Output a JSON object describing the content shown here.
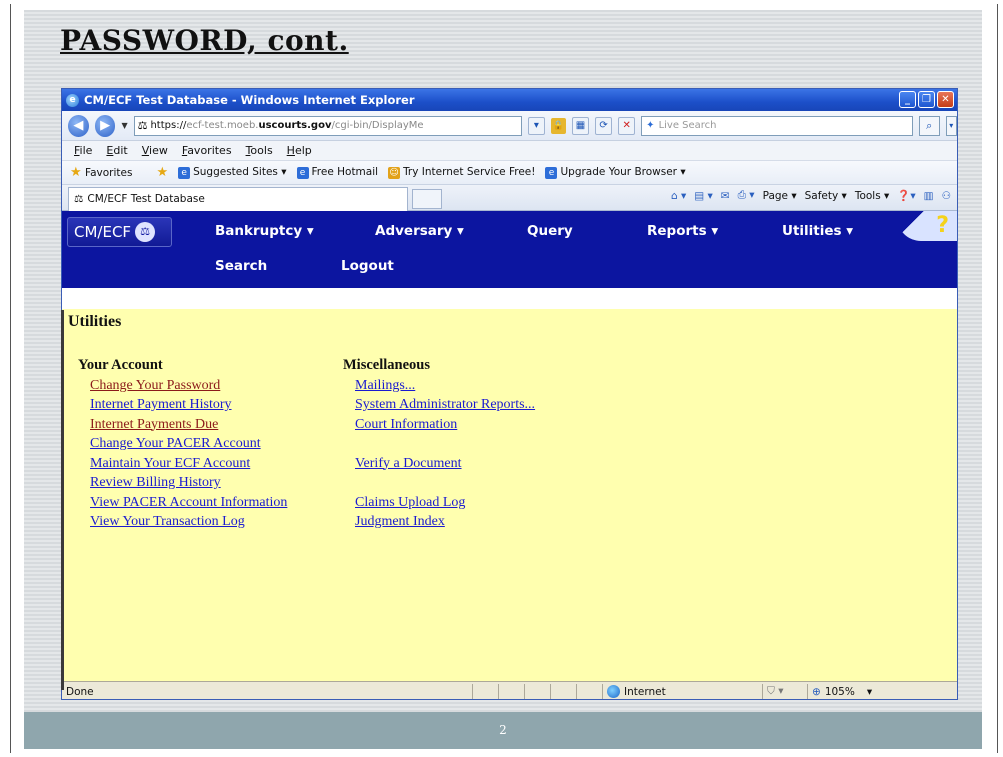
{
  "slide": {
    "title": "PASSWORD, cont.",
    "page_number": "2"
  },
  "window": {
    "title": "CM/ECF Test Database - Windows Internet Explorer",
    "address": {
      "scheme": "https://",
      "host_prefix": "ecf-test.moeb.",
      "host_domain": "uscourts.gov",
      "path": "/cgi-bin/DisplayMe"
    },
    "search_placeholder": "Live Search",
    "menu": [
      "File",
      "Edit",
      "View",
      "Favorites",
      "Tools",
      "Help"
    ],
    "favorites": {
      "label": "Favorites",
      "links": [
        "Suggested Sites ▾",
        "Free Hotmail",
        "Try Internet Service Free!",
        "Upgrade Your Browser ▾"
      ]
    },
    "tab_title": "CM/ECF Test Database",
    "command_bar": [
      "Page ▾",
      "Safety ▾",
      "Tools ▾"
    ],
    "status": {
      "text": "Done",
      "zone": "Internet",
      "zoom": "105%"
    }
  },
  "ecf": {
    "logo": "CM/ECF",
    "nav_row1": [
      "Bankruptcy ▾",
      "Adversary ▾",
      "Query",
      "Reports ▾",
      "Utilities ▾"
    ],
    "nav_row2": [
      "Search",
      "Logout"
    ],
    "page_title": "Utilities",
    "your_account": {
      "heading": "Your Account",
      "links": [
        "Change Your Password",
        "Internet Payment History",
        "Internet Payments Due",
        "Change Your PACER Account",
        "Maintain Your ECF Account",
        "Review Billing History",
        "View PACER Account Information",
        "View Your Transaction Log"
      ]
    },
    "miscellaneous": {
      "heading": "Miscellaneous",
      "links_group1": [
        "Mailings...",
        "System Administrator Reports...",
        "Court Information"
      ],
      "links_group2": [
        "Verify a Document"
      ],
      "links_group3": [
        "Claims Upload Log",
        "Judgment Index"
      ]
    }
  },
  "colors": {
    "nav_bg": "#0c15a0",
    "content_bg": "#ffffaf",
    "link": "#1a1ad0",
    "visited_link": "#8b1a1a",
    "footer": "#8fa6ad"
  }
}
